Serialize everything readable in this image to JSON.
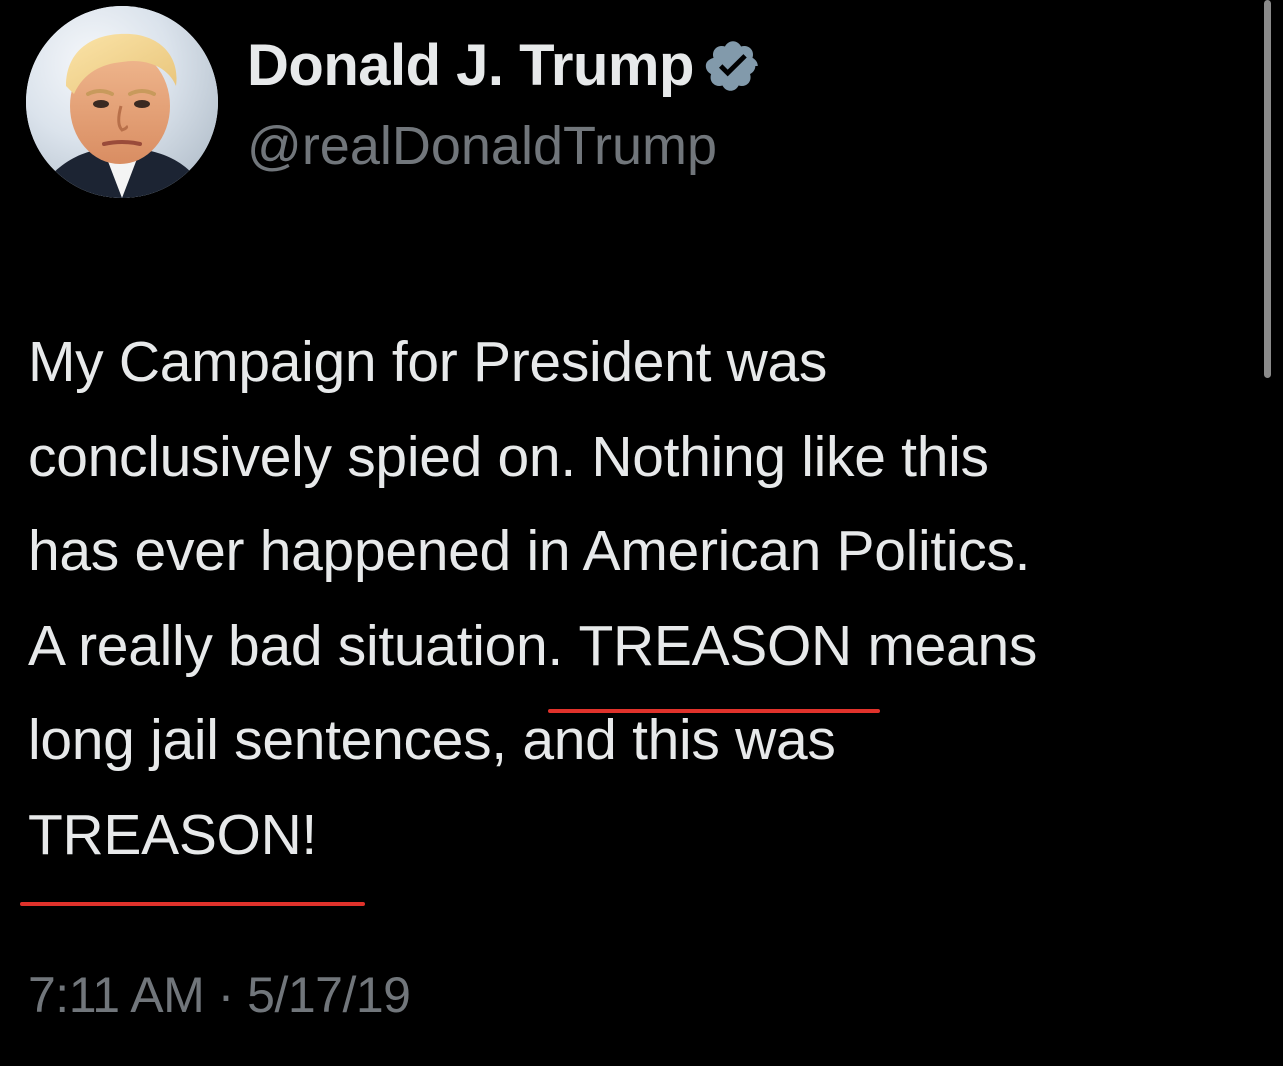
{
  "author": {
    "display_name": "Donald J. Trump",
    "handle": "@realDonaldTrump",
    "verified": true,
    "avatar_icon": "profile-photo-avatar",
    "verified_icon": "verified-badge-icon"
  },
  "tweet": {
    "lines": [
      {
        "text": "My Campaign for President was"
      },
      {
        "text": "conclusively spied on. Nothing like this"
      },
      {
        "text": "has ever happened in American Politics."
      },
      {
        "before": "A really bad situation. ",
        "marked": "TREASON",
        "after": " means"
      },
      {
        "text": "long jail sentences, and this was"
      },
      {
        "marked": "TREASON!"
      }
    ],
    "timestamp": "7:11 AM · 5/17/19"
  },
  "colors": {
    "background": "#000000",
    "primary_text": "#e7e9ea",
    "secondary_text": "#71767b",
    "verified_badge": "#829aab",
    "underline_mark": "#e0322b",
    "scrollbar": "#8a8a8a"
  }
}
